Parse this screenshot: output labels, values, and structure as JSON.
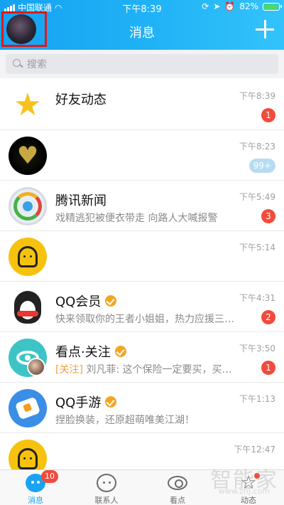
{
  "status_bar": {
    "carrier": "中国联通",
    "time": "下午8:39",
    "battery": "82%"
  },
  "header": {
    "title": "消息",
    "add_icon": "plus-icon"
  },
  "search": {
    "placeholder": "搜索"
  },
  "conversations": [
    {
      "name": "好友动态",
      "message": "",
      "time": "下午8:39",
      "badge": "1"
    },
    {
      "name": "",
      "message": "",
      "time": "下午8:23",
      "badge": "99+"
    },
    {
      "name": "腾讯新闻",
      "message": "戏精逃犯被便衣带走 向路人大喊报警",
      "time": "下午5:49",
      "badge": "3"
    },
    {
      "name": "",
      "message": "",
      "time": "下午5:14",
      "badge": ""
    },
    {
      "name": "QQ会员",
      "message": "快来领取你的王者小姐姐，热力应援三…",
      "time": "下午4:31",
      "badge": "2"
    },
    {
      "name": "看点·关注",
      "tag": "[关注]",
      "message": " 刘凡菲: 这个保险一定要买，买…",
      "time": "下午3:50",
      "badge": "1"
    },
    {
      "name": "QQ手游",
      "message": "捏脸换装，还原超萌唯美江湖！",
      "time": "下午1:13",
      "badge": ""
    },
    {
      "name": "",
      "message": "",
      "time": "下午12:47",
      "badge": ""
    }
  ],
  "tabbar": {
    "tabs": [
      {
        "label": "消息",
        "badge": "10"
      },
      {
        "label": "联系人"
      },
      {
        "label": "看点"
      },
      {
        "label": "动态"
      }
    ]
  },
  "watermark": {
    "text": "智能家",
    "sub": "www.znj.com"
  },
  "colors": {
    "header_start": "#16a2f3",
    "header_end": "#33c3fb",
    "badge_red": "#f24b3b",
    "accent": "#1aa3f2"
  }
}
